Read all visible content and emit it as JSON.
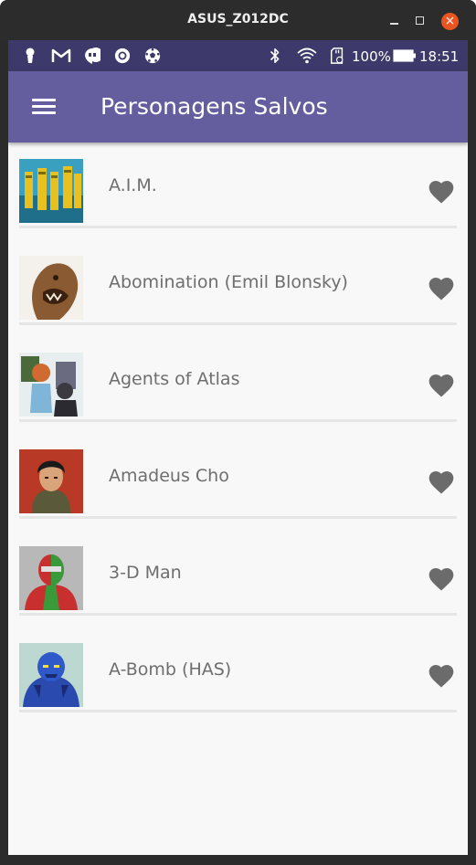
{
  "window": {
    "title": "ASUS_Z012DC",
    "close_glyph": "×"
  },
  "statusbar": {
    "left_icons": [
      "person-icon",
      "gmail-icon",
      "hangouts-icon",
      "record-icon",
      "soccer-ball-icon"
    ],
    "right_icons": [
      "bluetooth-icon",
      "wifi-icon",
      "sd-card-icon",
      "battery-icon"
    ],
    "battery": "100%",
    "time": "18:51"
  },
  "appbar": {
    "title": "Personagens Salvos",
    "menu_icon": "hamburger-menu-icon"
  },
  "colors": {
    "statusbar": "#3d3a6b",
    "appbar": "#645e9e",
    "background": "#f7f8f7",
    "text": "#6e6e6e",
    "heart": "#6b6b6b",
    "window_close": "#e95420"
  },
  "characters": [
    {
      "name": "A.I.M.",
      "favorite": true
    },
    {
      "name": "Abomination (Emil Blonsky)",
      "favorite": true
    },
    {
      "name": "Agents of Atlas",
      "favorite": true
    },
    {
      "name": "Amadeus Cho",
      "favorite": true
    },
    {
      "name": "3-D Man",
      "favorite": true
    },
    {
      "name": "A-Bomb (HAS)",
      "favorite": true
    }
  ]
}
